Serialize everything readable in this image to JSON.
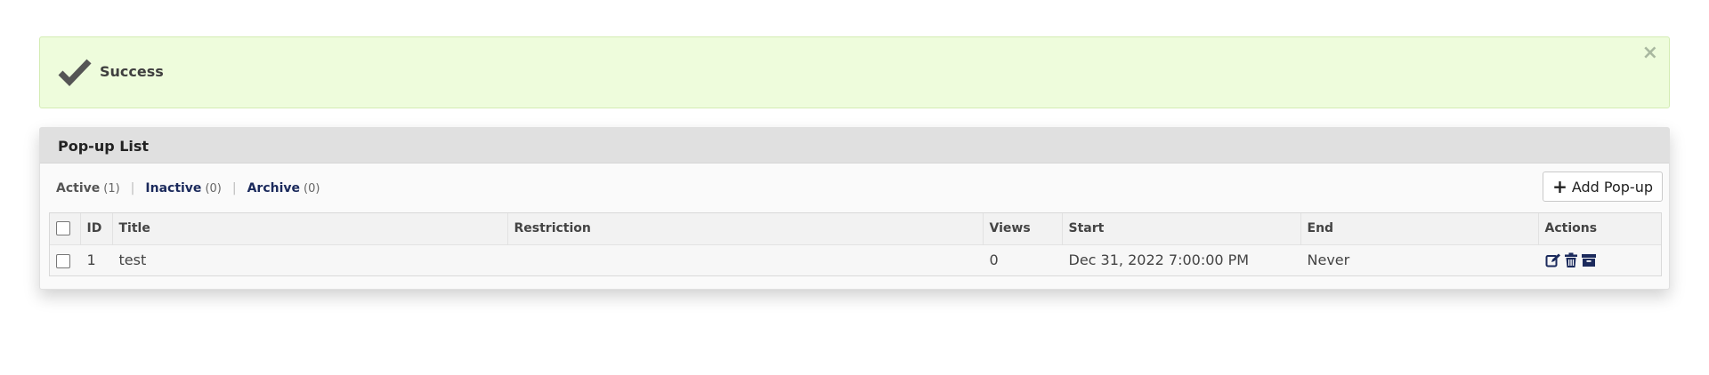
{
  "alert": {
    "message": "Success",
    "close_glyph": "×",
    "icon": "checkmark-icon"
  },
  "panel": {
    "title": "Pop-up List",
    "filters": [
      {
        "label": "Active",
        "count": "(1)"
      },
      {
        "label": "Inactive",
        "count": "(0)"
      },
      {
        "label": "Archive",
        "count": "(0)"
      }
    ],
    "separator": "|",
    "add_button": {
      "label": "Add Pop-up",
      "icon": "plus-icon"
    }
  },
  "table": {
    "columns": [
      "ID",
      "Title",
      "Restriction",
      "Views",
      "Start",
      "End",
      "Actions"
    ],
    "rows": [
      {
        "id": "1",
        "title": "test",
        "restriction": "",
        "views": "0",
        "start": "Dec 31, 2022 7:00:00 PM",
        "end": "Never",
        "actions": [
          "edit-icon",
          "trash-icon",
          "archive-icon"
        ]
      }
    ]
  },
  "colors": {
    "alert_bg": "#eefcdc",
    "link": "#1b2a5c",
    "header_bg": "#e0e0e0"
  }
}
